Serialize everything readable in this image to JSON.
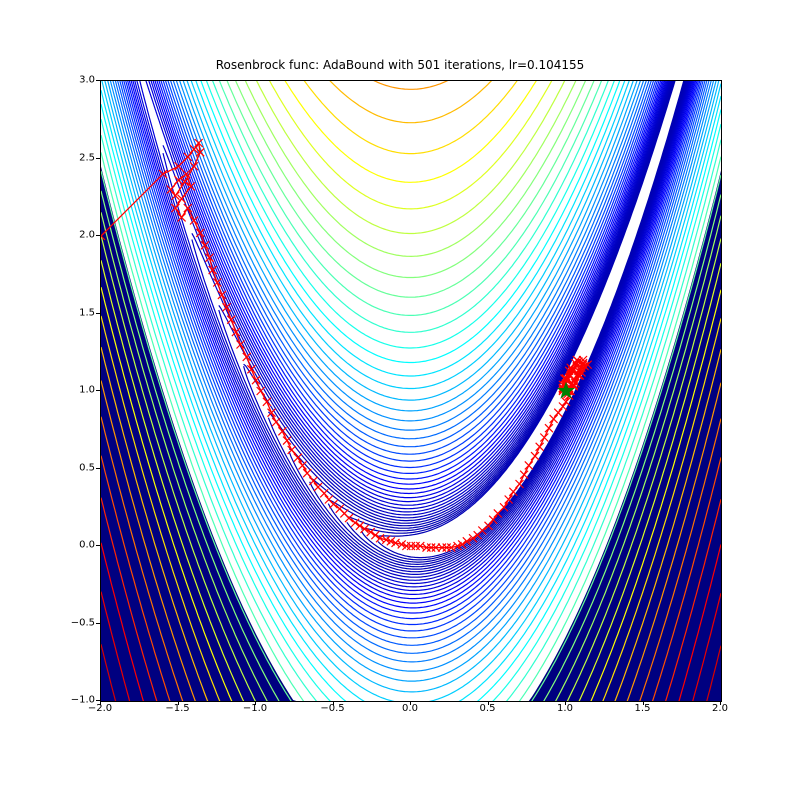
{
  "chart_data": {
    "type": "contour",
    "title": "Rosenbrock func: AdaBound with 501 iterations, lr=0.104155",
    "xlabel": "",
    "ylabel": "",
    "xlim": [
      -2.0,
      2.0
    ],
    "ylim": [
      -1.0,
      3.0
    ],
    "xticks": [
      -2.0,
      -1.5,
      -1.0,
      -0.5,
      0.0,
      0.5,
      1.0,
      1.5,
      2.0
    ],
    "yticks": [
      -1.0,
      -0.5,
      0.0,
      0.5,
      1.0,
      1.5,
      2.0,
      2.5,
      3.0
    ],
    "contour_function": "Rosenbrock: (1-x)^2 + 100*(y-x^2)^2",
    "contour_levels_approx": 50,
    "colormap": "jet",
    "optimizer": "AdaBound",
    "iterations": 501,
    "learning_rate": 0.104155,
    "start_point": [
      -2.0,
      2.0
    ],
    "minimum_point": [
      1.0,
      1.0
    ],
    "minimum_marker": {
      "symbol": "star",
      "color": "green"
    },
    "trajectory_marker": {
      "symbol": "x",
      "color": "red",
      "line": true
    },
    "trajectory": [
      [
        -2.0,
        2.0
      ],
      [
        -1.6,
        2.4
      ],
      [
        -1.5,
        2.45
      ],
      [
        -1.44,
        2.51
      ],
      [
        -1.4,
        2.56
      ],
      [
        -1.37,
        2.6
      ],
      [
        -1.36,
        2.54
      ],
      [
        -1.4,
        2.45
      ],
      [
        -1.46,
        2.35
      ],
      [
        -1.52,
        2.26
      ],
      [
        -1.55,
        2.3
      ],
      [
        -1.5,
        2.36
      ],
      [
        -1.45,
        2.4
      ],
      [
        -1.42,
        2.32
      ],
      [
        -1.48,
        2.24
      ],
      [
        -1.52,
        2.18
      ],
      [
        -1.48,
        2.12
      ],
      [
        -1.44,
        2.18
      ],
      [
        -1.4,
        2.1
      ],
      [
        -1.36,
        2.02
      ],
      [
        -1.33,
        1.94
      ],
      [
        -1.3,
        1.86
      ],
      [
        -1.28,
        1.78
      ],
      [
        -1.25,
        1.7
      ],
      [
        -1.22,
        1.62
      ],
      [
        -1.19,
        1.54
      ],
      [
        -1.16,
        1.46
      ],
      [
        -1.13,
        1.38
      ],
      [
        -1.1,
        1.3
      ],
      [
        -1.06,
        1.22
      ],
      [
        -1.03,
        1.14
      ],
      [
        -1.0,
        1.07
      ],
      [
        -0.97,
        1.0
      ],
      [
        -0.93,
        0.93
      ],
      [
        -0.9,
        0.86
      ],
      [
        -0.87,
        0.8
      ],
      [
        -0.83,
        0.74
      ],
      [
        -0.8,
        0.68
      ],
      [
        -0.77,
        0.62
      ],
      [
        -0.73,
        0.57
      ],
      [
        -0.7,
        0.52
      ],
      [
        -0.67,
        0.47
      ],
      [
        -0.63,
        0.42
      ],
      [
        -0.6,
        0.38
      ],
      [
        -0.56,
        0.34
      ],
      [
        -0.53,
        0.3
      ],
      [
        -0.5,
        0.27
      ],
      [
        -0.46,
        0.24
      ],
      [
        -0.43,
        0.21
      ],
      [
        -0.4,
        0.18
      ],
      [
        -0.36,
        0.15
      ],
      [
        -0.33,
        0.13
      ],
      [
        -0.3,
        0.11
      ],
      [
        -0.26,
        0.09
      ],
      [
        -0.23,
        0.07
      ],
      [
        -0.2,
        0.05
      ],
      [
        -0.16,
        0.04
      ],
      [
        -0.13,
        0.03
      ],
      [
        -0.1,
        0.02
      ],
      [
        -0.06,
        0.01
      ],
      [
        -0.03,
        0.0
      ],
      [
        0.0,
        0.0
      ],
      [
        0.03,
        0.0
      ],
      [
        0.06,
        0.0
      ],
      [
        0.1,
        -0.01
      ],
      [
        0.13,
        -0.01
      ],
      [
        0.16,
        -0.01
      ],
      [
        0.2,
        -0.01
      ],
      [
        0.23,
        -0.01
      ],
      [
        0.26,
        -0.01
      ],
      [
        0.3,
        0.0
      ],
      [
        0.33,
        0.01
      ],
      [
        0.36,
        0.03
      ],
      [
        0.4,
        0.05
      ],
      [
        0.43,
        0.07
      ],
      [
        0.46,
        0.1
      ],
      [
        0.5,
        0.13
      ],
      [
        0.53,
        0.17
      ],
      [
        0.56,
        0.21
      ],
      [
        0.6,
        0.25
      ],
      [
        0.63,
        0.3
      ],
      [
        0.66,
        0.35
      ],
      [
        0.7,
        0.4
      ],
      [
        0.73,
        0.46
      ],
      [
        0.76,
        0.52
      ],
      [
        0.8,
        0.58
      ],
      [
        0.83,
        0.64
      ],
      [
        0.86,
        0.7
      ],
      [
        0.89,
        0.76
      ],
      [
        0.92,
        0.82
      ],
      [
        0.95,
        0.86
      ],
      [
        0.98,
        0.9
      ],
      [
        1.0,
        0.93
      ],
      [
        1.02,
        0.97
      ],
      [
        1.03,
        1.0
      ],
      [
        1.05,
        1.04
      ],
      [
        1.08,
        1.1
      ],
      [
        1.1,
        1.15
      ],
      [
        1.06,
        1.18
      ],
      [
        1.02,
        1.13
      ],
      [
        1.0,
        1.08
      ],
      [
        0.98,
        1.04
      ],
      [
        1.02,
        1.0
      ],
      [
        1.06,
        1.05
      ],
      [
        1.1,
        1.12
      ],
      [
        1.14,
        1.17
      ],
      [
        1.11,
        1.2
      ],
      [
        1.07,
        1.16
      ],
      [
        1.03,
        1.1
      ],
      [
        1.0,
        1.05
      ],
      [
        0.98,
        1.0
      ],
      [
        1.01,
        0.98
      ],
      [
        1.05,
        1.03
      ],
      [
        1.09,
        1.1
      ],
      [
        1.12,
        1.16
      ],
      [
        1.08,
        1.19
      ],
      [
        1.04,
        1.14
      ],
      [
        1.0,
        1.08
      ],
      [
        0.98,
        1.02
      ],
      [
        1.0,
        1.0
      ],
      [
        1.02,
        1.02
      ],
      [
        1.05,
        1.07
      ],
      [
        1.08,
        1.13
      ],
      [
        1.11,
        1.18
      ],
      [
        1.07,
        1.2
      ],
      [
        1.03,
        1.15
      ],
      [
        0.99,
        1.08
      ],
      [
        0.98,
        1.02
      ],
      [
        1.01,
        1.0
      ],
      [
        1.04,
        1.05
      ],
      [
        1.08,
        1.11
      ],
      [
        1.11,
        1.17
      ],
      [
        1.08,
        1.19
      ],
      [
        1.04,
        1.13
      ],
      [
        1.0,
        1.07
      ],
      [
        0.98,
        1.01
      ],
      [
        1.0,
        1.0
      ]
    ]
  }
}
